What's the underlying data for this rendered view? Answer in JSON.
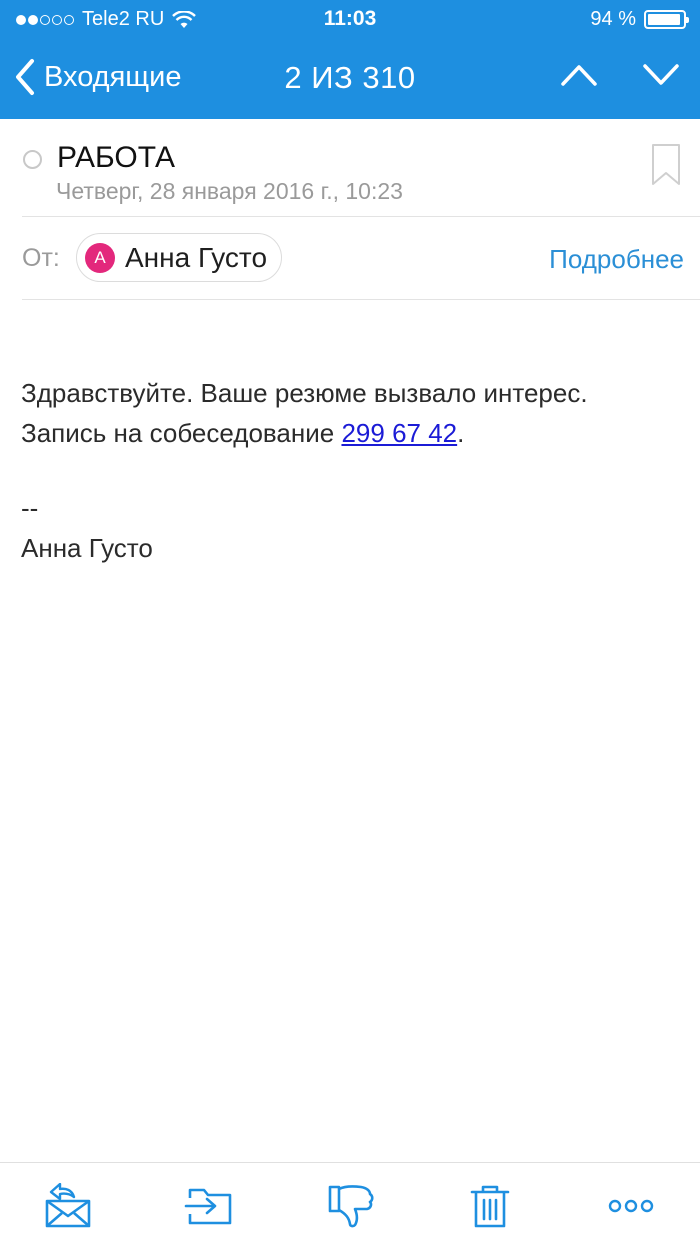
{
  "status_bar": {
    "carrier": "Tele2 RU",
    "time": "11:03",
    "battery": "94 %",
    "battery_level": 0.94
  },
  "nav": {
    "back_label": "Входящие",
    "counter": "2 ИЗ 310"
  },
  "email": {
    "subject": "РАБОТА",
    "date": "Четверг, 28 января 2016 г., 10:23",
    "from_label": "От:",
    "sender_initial": "А",
    "sender_name": "Анна Густо",
    "details_link": "Подробнее",
    "body_line1": "Здравствуйте. Ваше резюме вызвало интерес.",
    "body_line2_prefix": "Запись на собеседование ",
    "phone": "299 67 42",
    "body_line2_suffix": ".",
    "signature_dashes": "--",
    "signature_name": "Анна Густо"
  },
  "colors": {
    "header_blue": "#1e8fe0",
    "link_blue": "#2b8fd6",
    "avatar_pink": "#e3287c",
    "phone_link": "#1b1bd6"
  },
  "toolbar": {
    "icons": [
      "reply-icon",
      "move-to-folder-icon",
      "spam-icon",
      "trash-icon",
      "more-icon"
    ]
  }
}
